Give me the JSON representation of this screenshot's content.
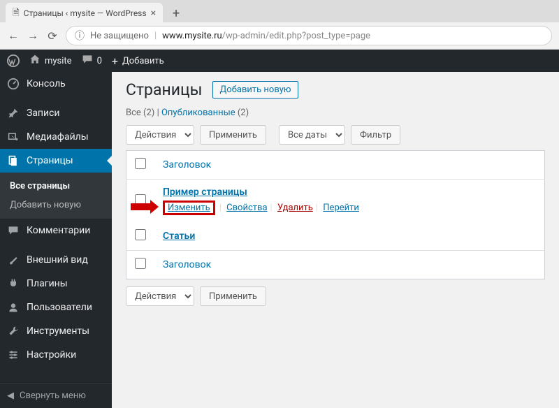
{
  "browser": {
    "tab_title": "Страницы ‹ mysite — WordPress",
    "insecure_label": "Не защищено",
    "url_host": "www.mysite.ru",
    "url_path": "/wp-admin/edit.php?post_type=page"
  },
  "adminbar": {
    "site_name": "mysite",
    "comments_count": "0",
    "add_new": "Добавить"
  },
  "sidebar": {
    "items": [
      {
        "label": "Консоль"
      },
      {
        "label": "Записи"
      },
      {
        "label": "Медиафайлы"
      },
      {
        "label": "Страницы"
      },
      {
        "label": "Комментарии"
      },
      {
        "label": "Внешний вид"
      },
      {
        "label": "Плагины"
      },
      {
        "label": "Пользователи"
      },
      {
        "label": "Инструменты"
      },
      {
        "label": "Настройки"
      }
    ],
    "submenu": {
      "all": "Все страницы",
      "add": "Добавить новую"
    },
    "collapse": "Свернуть меню"
  },
  "page": {
    "title": "Страницы",
    "add_new": "Добавить новую",
    "filters": {
      "all_label": "Все",
      "all_count": "(2)",
      "published_label": "Опубликованные",
      "published_count": "(2)"
    },
    "bulk_action_label": "Действия",
    "apply_label": "Применить",
    "date_filter_label": "Все даты",
    "filter_button": "Фильтр",
    "col_title": "Заголовок",
    "rows": [
      {
        "title": "Пример страницы",
        "actions": {
          "edit": "Изменить",
          "quick": "Свойства",
          "trash": "Удалить",
          "view": "Перейти"
        }
      },
      {
        "title": "Статьи"
      }
    ]
  }
}
